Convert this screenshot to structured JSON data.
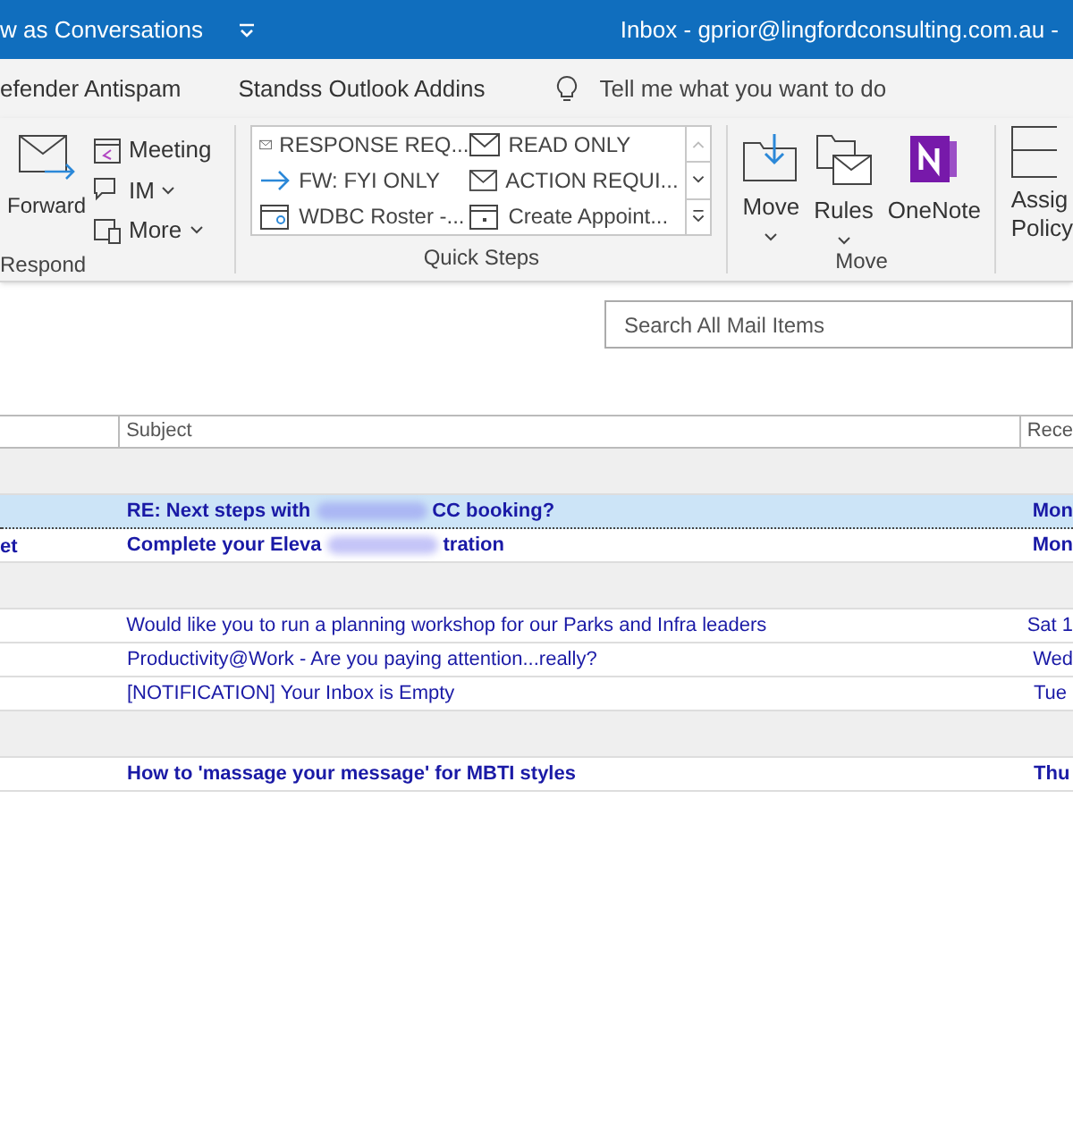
{
  "title_bar": {
    "left": "w as Conversations",
    "right": "Inbox - gprior@lingfordconsulting.com.au  -"
  },
  "tabs": [
    "efender Antispam",
    "Standss Outlook Addins"
  ],
  "tell_me": {
    "placeholder": "Tell me what you want to do"
  },
  "respond": {
    "forward": "Forward",
    "meeting": "Meeting",
    "im": "IM",
    "more": "More",
    "label": "Respond"
  },
  "quick_steps": {
    "label": "Quick Steps",
    "items": [
      {
        "kind": "mail",
        "label": "RESPONSE REQ..."
      },
      {
        "kind": "mail",
        "label": "READ ONLY"
      },
      {
        "kind": "arrow",
        "label": "FW: FYI ONLY"
      },
      {
        "kind": "mail",
        "label": "ACTION REQUI..."
      },
      {
        "kind": "roster",
        "label": "WDBC Roster -..."
      },
      {
        "kind": "calendar",
        "label": "Create Appoint..."
      }
    ]
  },
  "move": {
    "label": "Move",
    "buttons": [
      {
        "kind": "move",
        "label": "Move"
      },
      {
        "kind": "rules",
        "label": "Rules"
      },
      {
        "kind": "onenote",
        "label": "OneNote"
      }
    ]
  },
  "assign": {
    "line1": "Assig",
    "line2": "Policy"
  },
  "search": {
    "placeholder": "Search All Mail Items"
  },
  "table": {
    "columns": [
      "Subject",
      "Rece"
    ],
    "rows": [
      {
        "kind": "group"
      },
      {
        "kind": "mail",
        "from": "",
        "subject": "RE: Next steps with",
        "subject_end": "CC booking?",
        "redacted": true,
        "received": "Mon",
        "unread": true,
        "selected": true
      },
      {
        "kind": "mail",
        "from": "et",
        "subject": "Complete your Eleva",
        "subject_end": "tration",
        "redacted": true,
        "received": "Mon",
        "unread": true,
        "selected": false
      },
      {
        "kind": "group"
      },
      {
        "kind": "mail",
        "from": "",
        "subject": "Would like you to run a planning workshop for our Parks and Infra leaders",
        "redacted": false,
        "received": "Sat 1",
        "unread": false,
        "selected": false
      },
      {
        "kind": "mail",
        "from": "",
        "subject": "Productivity@Work - Are you paying attention...really?",
        "redacted": false,
        "received": "Wed",
        "unread": false,
        "selected": false
      },
      {
        "kind": "mail",
        "from": "",
        "subject": "[NOTIFICATION] Your Inbox is Empty",
        "redacted": false,
        "received": "Tue",
        "unread": false,
        "selected": false
      },
      {
        "kind": "group"
      },
      {
        "kind": "mail",
        "from": "",
        "subject": "How to 'massage your message' for MBTI styles",
        "redacted": false,
        "received": "Thu",
        "unread": true,
        "selected": false
      }
    ]
  }
}
